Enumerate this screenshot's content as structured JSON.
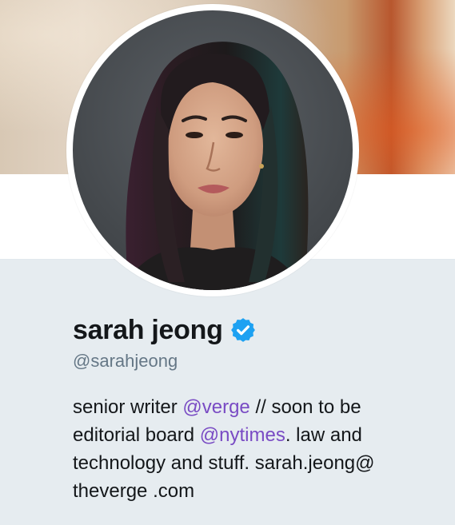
{
  "profile": {
    "name": "sarah jeong",
    "verified": true,
    "handle": "@sarahjeong",
    "bio": {
      "line1_text": "senior writer ",
      "mention1": "@verge",
      "line1_rest": " // soon to be",
      "line2_text": "editorial board ",
      "mention2": "@nytimes",
      "line2_rest": ". law and",
      "line3": "technology and stuff. sarah.jeong@",
      "line4": "theverge .com"
    }
  },
  "colors": {
    "background": "#e6ecf0",
    "name": "#14171a",
    "handle": "#657786",
    "mention": "#794bc4",
    "verified_badge": "#1da1f2"
  },
  "icons": {
    "verified": "verified-badge-icon"
  }
}
